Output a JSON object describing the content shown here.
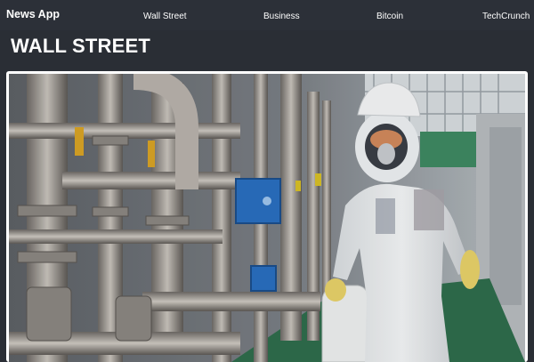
{
  "navbar": {
    "brand": "News App",
    "links": [
      "Wall Street",
      "Business",
      "Bitcoin",
      "TechCrunch"
    ]
  },
  "page": {
    "title": "WALL STREET"
  },
  "hero": {
    "image_alt": "Worker in white protective suit and gas mask carrying a container through an industrial plant"
  },
  "colors": {
    "navbar_bg": "#2c3038",
    "page_bg": "#2a2e35",
    "text": "#ffffff"
  }
}
